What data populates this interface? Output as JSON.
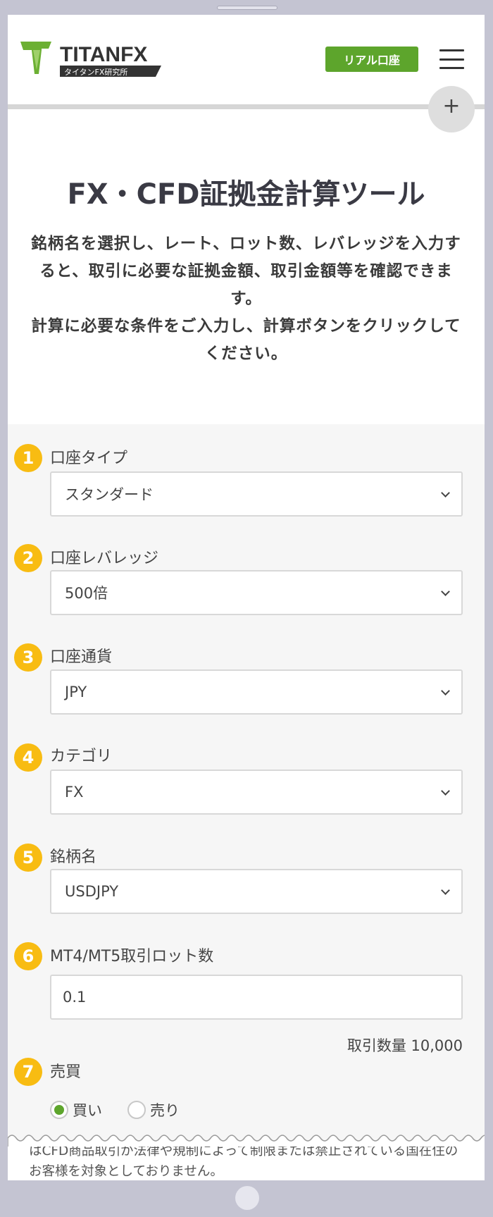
{
  "header": {
    "logo_text": "TITANFX",
    "logo_subtext": "タイタンFX研究所",
    "real_account_label": "リアル口座",
    "menu_icon": "hamburger-icon",
    "expand_icon": "plus-icon",
    "expand_symbol": "+"
  },
  "intro": {
    "title": "FX・CFD証拠金計算ツール",
    "description_line1": "銘柄名を選択し、レート、ロット数、レバレッジを入力すると、取引に必要な証拠金額、取引金額等を確認できます。",
    "description_line2": "計算に必要な条件をご入力し、計算ボタンをクリックしてください。"
  },
  "form": {
    "steps": [
      {
        "number": "1",
        "label": "口座タイプ",
        "value": "スタンダード"
      },
      {
        "number": "2",
        "label": "口座レバレッジ",
        "value": "500倍"
      },
      {
        "number": "3",
        "label": "口座通貨",
        "value": "JPY"
      },
      {
        "number": "4",
        "label": "カテゴリ",
        "value": "FX"
      },
      {
        "number": "5",
        "label": "銘柄名",
        "value": "USDJPY"
      },
      {
        "number": "6",
        "label": "MT4/MT5取引ロット数",
        "value": "0.1"
      },
      {
        "number": "7",
        "label": "売買"
      }
    ],
    "trade_volume": "取引数量 10,000",
    "buy_label": "買い",
    "sell_label": "売り",
    "selected_side": "buy"
  },
  "footer": {
    "note": "はCFD商品取引が法律や規制によって制限または禁止されている国在住のお客様を対象としておりません。"
  },
  "colors": {
    "brand_green": "#5da52c",
    "step_yellow": "#f8bc12",
    "frame": "#c4c4d2"
  }
}
